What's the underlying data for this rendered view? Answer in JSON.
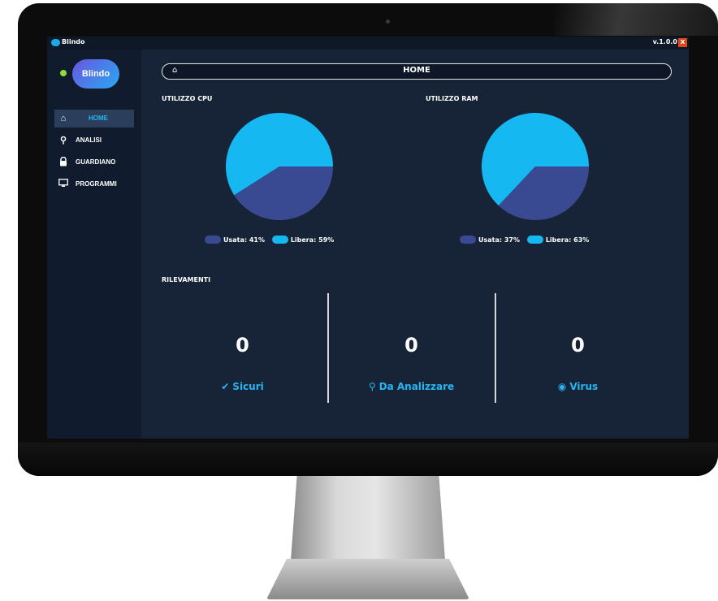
{
  "window": {
    "title": "Blindo",
    "version": "v.1.0.0",
    "close_label": "x"
  },
  "logo": {
    "text": "Blindo"
  },
  "sidebar": {
    "items": [
      {
        "label": "HOME",
        "icon": "home-icon",
        "glyph": "⌂",
        "active": true
      },
      {
        "label": "ANALISI",
        "icon": "search-icon",
        "glyph": "⚲",
        "active": false
      },
      {
        "label": "GUARDIANO",
        "icon": "lock-icon",
        "glyph": "🔒",
        "active": false
      },
      {
        "label": "PROGRAMMI",
        "icon": "monitor-icon",
        "glyph": "▭",
        "active": false
      }
    ]
  },
  "header": {
    "title": "HOME",
    "icon": "home-icon"
  },
  "cpu": {
    "title": "UTILIZZO CPU",
    "used_pct": 41,
    "free_pct": 59,
    "used_label": "Usata: 41%",
    "free_label": "Libera: 59%"
  },
  "ram": {
    "title": "UTILIZZO RAM",
    "used_pct": 37,
    "free_pct": 63,
    "used_label": "Usata: 37%",
    "free_label": "Libera: 63%"
  },
  "colors": {
    "used": "#3a4a92",
    "free": "#16b8f2",
    "accent": "#28b6f3",
    "background": "#172437"
  },
  "detections": {
    "title": "RILEVAMENTI",
    "items": [
      {
        "count": "0",
        "label": "Sicuri",
        "icon": "shield-check-icon",
        "glyph": "✔"
      },
      {
        "count": "0",
        "label": "Da Analizzare",
        "icon": "search-icon",
        "glyph": "⚲"
      },
      {
        "count": "0",
        "label": "Virus",
        "icon": "virus-shield-icon",
        "glyph": "◉"
      }
    ]
  }
}
